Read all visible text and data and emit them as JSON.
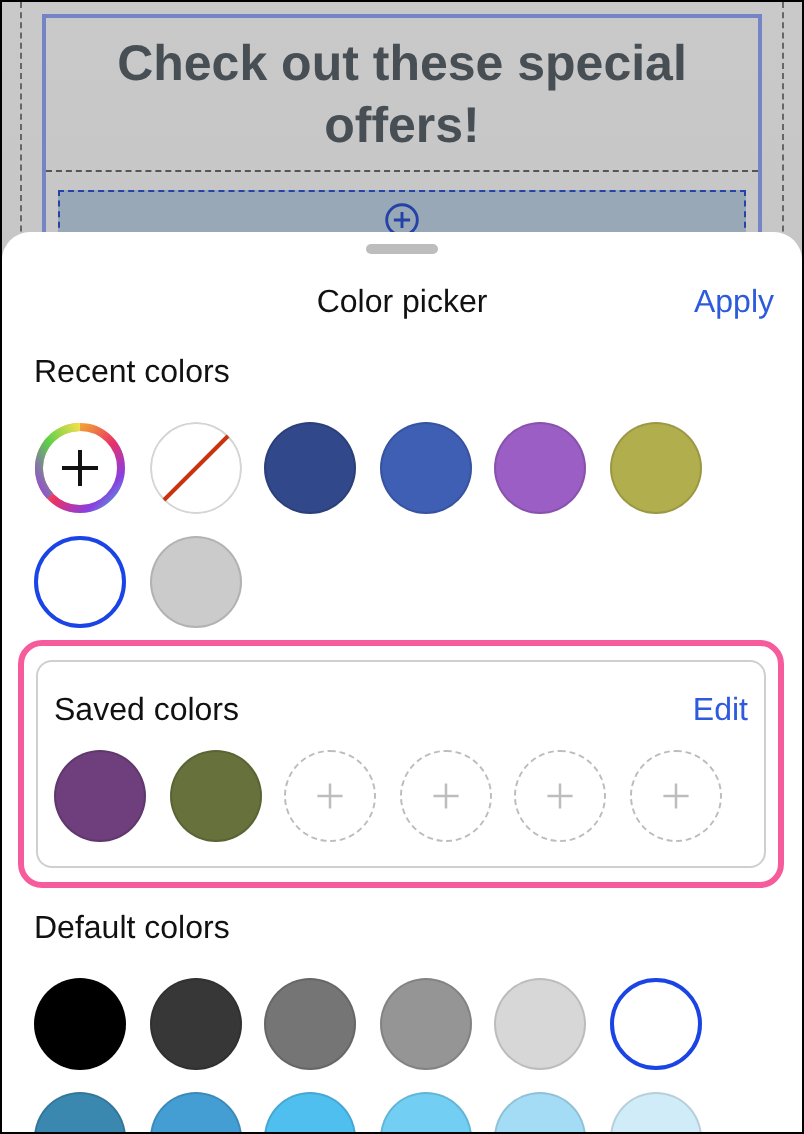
{
  "background": {
    "heading": "Check out these special offers!"
  },
  "sheet": {
    "title": "Color picker",
    "action": "Apply"
  },
  "recent": {
    "label": "Recent colors",
    "swatches": [
      {
        "kind": "picker",
        "selected": false
      },
      {
        "kind": "none",
        "selected": false
      },
      {
        "kind": "color",
        "color": "#31488a",
        "selected": false
      },
      {
        "kind": "color",
        "color": "#3f5fb5",
        "selected": false
      },
      {
        "kind": "color",
        "color": "#9b5ec4",
        "selected": false
      },
      {
        "kind": "color",
        "color": "#b1ae4e",
        "selected": false
      },
      {
        "kind": "color",
        "color": "#ffffff",
        "selected": true
      },
      {
        "kind": "color",
        "color": "#cbcbcb",
        "selected": false
      }
    ]
  },
  "saved": {
    "label": "Saved colors",
    "action": "Edit",
    "swatches": [
      {
        "kind": "color",
        "color": "#6e3f7c",
        "selected": false
      },
      {
        "kind": "color",
        "color": "#67713c",
        "selected": false
      },
      {
        "kind": "add",
        "selected": false
      },
      {
        "kind": "add",
        "selected": false
      },
      {
        "kind": "add",
        "selected": false
      },
      {
        "kind": "add",
        "selected": false
      }
    ]
  },
  "default": {
    "label": "Default colors",
    "swatches": [
      {
        "kind": "color",
        "color": "#000000",
        "selected": false
      },
      {
        "kind": "color",
        "color": "#373737",
        "selected": false
      },
      {
        "kind": "color",
        "color": "#757575",
        "selected": false
      },
      {
        "kind": "color",
        "color": "#959595",
        "selected": false
      },
      {
        "kind": "color",
        "color": "#d7d7d7",
        "selected": false
      },
      {
        "kind": "color",
        "color": "#ffffff",
        "selected": true
      },
      {
        "kind": "color",
        "color": "#3a88b0",
        "selected": false
      },
      {
        "kind": "color",
        "color": "#449ed3",
        "selected": false
      },
      {
        "kind": "color",
        "color": "#4fbff0",
        "selected": false
      },
      {
        "kind": "color",
        "color": "#72cff3",
        "selected": false
      },
      {
        "kind": "color",
        "color": "#a4dcf5",
        "selected": false
      },
      {
        "kind": "color",
        "color": "#d0ecf8",
        "selected": false
      }
    ]
  }
}
